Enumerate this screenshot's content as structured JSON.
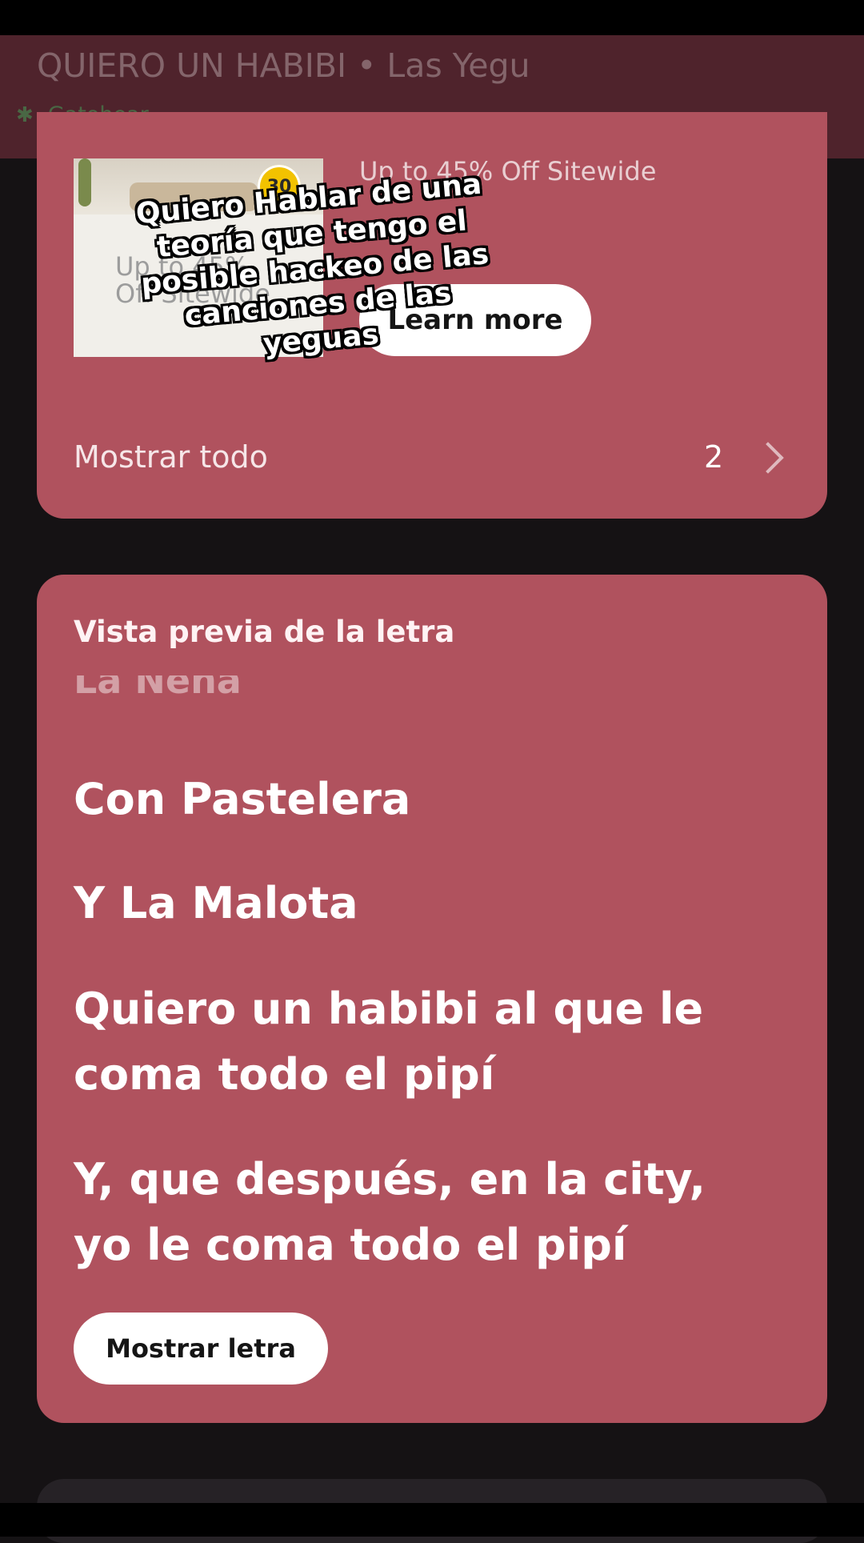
{
  "player": {
    "track_title": "QUIERO UN HABIBI • Las Yegu",
    "device_name": "Gatohear",
    "device_icon": "bluetooth-icon"
  },
  "ad": {
    "badge": "30",
    "image_text": "Up to 45% Off Sitewide",
    "headline": "Up to 45% Off Sitewide",
    "cta_label": "Learn more",
    "show_all_label": "Mostrar todo",
    "show_all_count": "2"
  },
  "overlay_caption": "Quiero Hablar de una teoría que tengo el posible hackeo de las canciones de las yeguas",
  "lyrics": {
    "heading": "Vista previa de la letra",
    "faded_line": "La Nena",
    "lines": [
      "Con Pastelera",
      "Y La Malota",
      "Quiero un habibi al que le coma todo el pipí",
      "Y, que después, en la city, yo le coma todo el pipí"
    ],
    "show_lyrics_label": "Mostrar letra"
  },
  "colors": {
    "card": "#b0525e",
    "header": "#4f232c",
    "background": "#151214"
  }
}
